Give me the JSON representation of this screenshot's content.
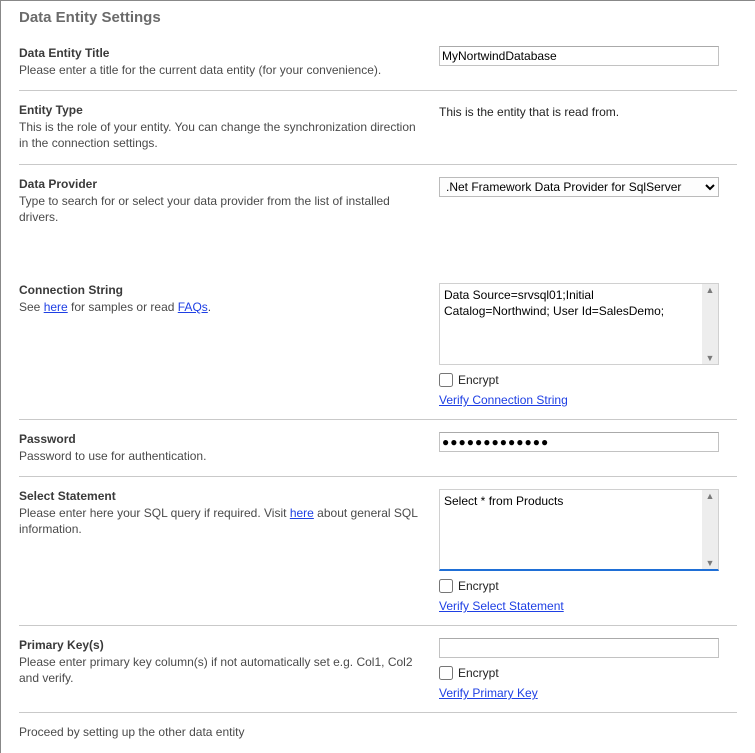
{
  "title": "Data Entity Settings",
  "entityTitle": {
    "label": "Data Entity Title",
    "desc": "Please enter a title for the current data entity (for your convenience).",
    "value": "MyNortwindDatabase"
  },
  "entityType": {
    "label": "Entity Type",
    "desc": "This is the role of your entity. You can change the synchronization direction in the connection settings.",
    "static": "This is the entity that is read from."
  },
  "dataProvider": {
    "label": "Data Provider",
    "desc": "Type to search for or select your data provider from the list of installed drivers.",
    "value": ".Net Framework Data Provider for SqlServer"
  },
  "connString": {
    "label": "Connection String",
    "descPrefix": "See ",
    "descLink1": "here",
    "descMid": " for samples or read ",
    "descLink2": "FAQs",
    "descSuffix": ".",
    "value": "Data Source=srvsql01;Initial Catalog=Northwind; User Id=SalesDemo;",
    "encryptLabel": "Encrypt",
    "verifyLabel": "Verify Connection String"
  },
  "password": {
    "label": "Password",
    "desc": "Password to use for authentication.",
    "value": "●●●●●●●●●●●●●"
  },
  "selectStmt": {
    "label": "Select Statement",
    "descPrefix": "Please enter here your SQL query if required. Visit ",
    "descLink": "here",
    "descSuffix": " about general SQL information.",
    "value": "Select * from Products",
    "encryptLabel": "Encrypt",
    "verifyLabel": "Verify Select Statement"
  },
  "primaryKey": {
    "label": "Primary Key(s)",
    "desc": "Please enter primary key column(s) if not automatically set e.g. Col1, Col2 and verify.",
    "value": "",
    "encryptLabel": "Encrypt",
    "verifyLabel": "Verify Primary Key"
  },
  "footer": "Proceed by setting up the other data entity"
}
